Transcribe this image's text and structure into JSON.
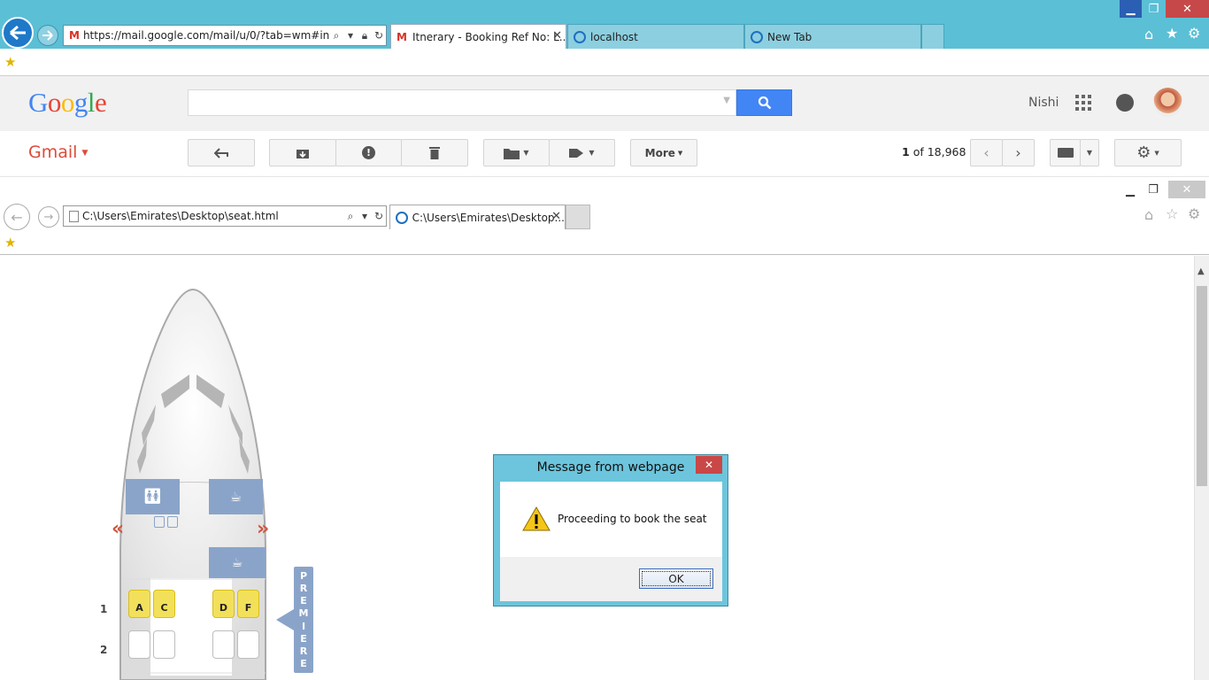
{
  "outer_browser": {
    "address": "https://mail.google.com/mail/u/0/?tab=wm#inbox",
    "tabs": [
      {
        "label": "Itnerary - Booking Ref No: L...",
        "active": true
      },
      {
        "label": "localhost",
        "active": false
      },
      {
        "label": "New Tab",
        "active": false
      }
    ]
  },
  "gmail": {
    "logo": "Google",
    "app_label": "Gmail",
    "user_name": "Nishi",
    "more_label": "More",
    "pager_bold": "1",
    "pager_rest": "of 18,968"
  },
  "inner_browser": {
    "address": "C:\\Users\\Emirates\\Desktop\\seat.html",
    "tab_label": "C:\\Users\\Emirates\\Desktop..."
  },
  "seatmap": {
    "rows": [
      "1",
      "2"
    ],
    "seats_row1": [
      "A",
      "C",
      "D",
      "F"
    ],
    "cabin_label": [
      "P",
      "R",
      "E",
      "M",
      "I",
      "E",
      "R",
      "E"
    ]
  },
  "dialog": {
    "title": "Message from webpage",
    "message": "Proceeding to book the seat",
    "ok_label": "OK"
  },
  "colors": {
    "ie_frame": "#5bbfd6",
    "gmail_red": "#dd4b39",
    "search_blue": "#4285f4",
    "seat_selected": "#f3e05a",
    "galley": "#8aa4c9"
  }
}
